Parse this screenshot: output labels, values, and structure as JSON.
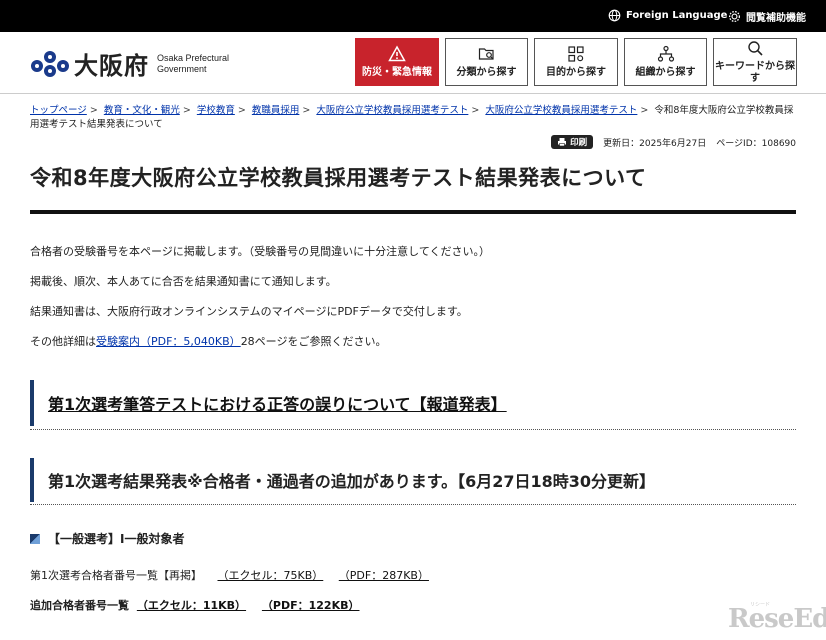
{
  "topbar": {
    "foreign_language": "Foreign Language",
    "accessibility": "閲覧補助機能"
  },
  "header": {
    "logo_name": "大阪府",
    "logo_sub_line1": "Osaka Prefectural",
    "logo_sub_line2": "Government",
    "nav": [
      {
        "label": "防災・緊急情報",
        "icon": "warning-icon"
      },
      {
        "label": "分類から探す",
        "icon": "folder-search-icon"
      },
      {
        "label": "目的から探す",
        "icon": "grid-icon"
      },
      {
        "label": "組織から探す",
        "icon": "org-chart-icon"
      },
      {
        "label": "キーワードから探す",
        "icon": "search-icon"
      }
    ]
  },
  "breadcrumb": [
    "トップページ",
    "教育・文化・観光",
    "学校教育",
    "教職員採用",
    "大阪府公立学校教員採用選考テスト",
    "大阪府公立学校教員採用選考テスト"
  ],
  "breadcrumb_current": "令和8年度大阪府公立学校教員採用選考テスト結果発表について",
  "meta": {
    "print_label": "印刷",
    "updated": "更新日：2025年6月27日",
    "page_id": "ページID：108690"
  },
  "page_title": "令和8年度大阪府公立学校教員採用選考テスト結果発表について",
  "paragraphs": {
    "p1": "合格者の受験番号を本ページに掲載します。（受験番号の見間違いに十分注意してください。）",
    "p2": "掲載後、順次、本人あてに合否を結果通知書にて通知します。",
    "p3": "結果通知書は、大阪府行政オンラインシステムのマイページにPDFデータで交付します。",
    "p4_prefix": "その他詳細は",
    "p4_link": "受験案内（PDF：5,040KB）",
    "p4_suffix": "28ページをご参照ください。"
  },
  "sections": {
    "s1": "第1次選考筆答テストにおける正答の誤りについて【報道発表】",
    "s2": "第1次選考結果発表※合格者・通過者の追加があります。【6月27日18時30分更新】"
  },
  "sub_heading": "【一般選考】Ⅰ一般対象者",
  "lines": {
    "l1_label": "第1次選考合格者番号一覧【再掲】",
    "l1_excel": "（エクセル：75KB）",
    "l1_pdf": "（PDF：287KB）",
    "l2_label": "追加合格者番号一覧",
    "l2_excel": "（エクセル：11KB）",
    "l2_pdf": "（PDF：122KB）"
  },
  "watermark": {
    "text": "ReseEd",
    "small": "リシード"
  }
}
